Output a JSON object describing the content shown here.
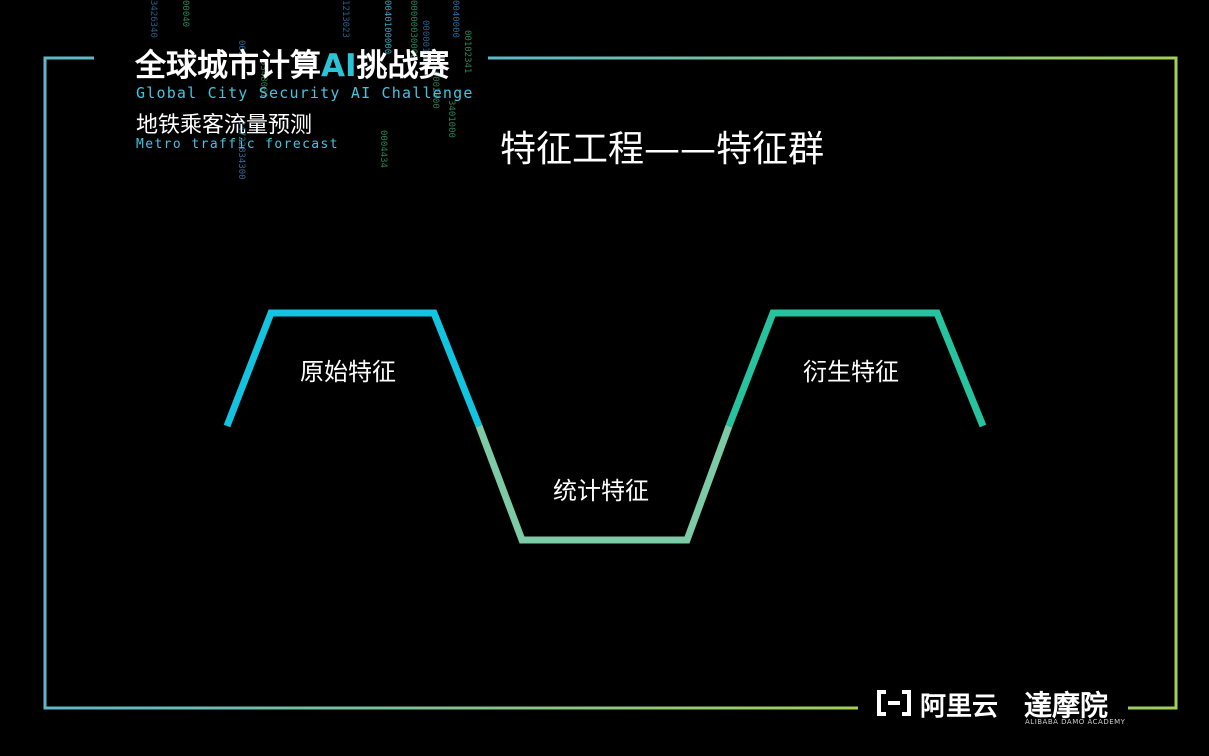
{
  "header": {
    "title_part1": "全球城市计算",
    "title_ai": "AI",
    "title_part2": "挑战赛",
    "title_en": "Global City Security AI Challenge",
    "subtitle_cn": "地铁乘客流量预测",
    "subtitle_en": "Metro traffic forecast"
  },
  "slide": {
    "title": "特征工程——特征群"
  },
  "diagram": {
    "labels": [
      "原始特征",
      "统计特征",
      "衍生特征"
    ]
  },
  "footer": {
    "aliyun_logo": "阿里云",
    "damo_logo": "達摩院",
    "damo_en": "ALIBABA DAMO ACADEMY"
  },
  "matrix": {
    "columns": [
      "3426340",
      "00040",
      "000",
      "5348001",
      "1213023",
      "34722834300",
      "0004434",
      "0040100000",
      "00000030000",
      "000001234",
      "340002800",
      "3401000",
      "0040000",
      "00102341"
    ]
  },
  "colors": {
    "cyan": "#12c4e0",
    "teal": "#27c39e",
    "mint": "#7ccaa6",
    "frame_left": "#5fb7c9",
    "frame_right": "#9ccf5e"
  }
}
